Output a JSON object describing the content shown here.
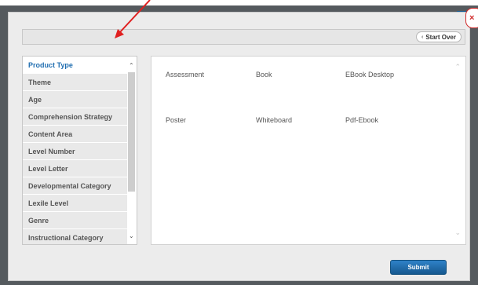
{
  "modal": {
    "close_label": "×",
    "start_over_label": "Start Over",
    "start_over_icon": "chevron-left-icon",
    "submit_label": "Submit"
  },
  "categories": [
    {
      "label": "Product Type",
      "active": true
    },
    {
      "label": "Theme"
    },
    {
      "label": "Age"
    },
    {
      "label": "Comprehension Strategy"
    },
    {
      "label": "Content Area"
    },
    {
      "label": "Level Number"
    },
    {
      "label": "Level Letter"
    },
    {
      "label": "Developmental Category"
    },
    {
      "label": "Lexile Level"
    },
    {
      "label": "Genre"
    },
    {
      "label": "Instructional Category"
    }
  ],
  "options": [
    "Assessment",
    "Book",
    "EBook Desktop",
    "Poster",
    "Whiteboard",
    "Pdf-Ebook"
  ],
  "colors": {
    "accent": "#1f6db0",
    "close": "#d02a2a",
    "arrow": "#e02020",
    "submit": "#1b64a3"
  }
}
